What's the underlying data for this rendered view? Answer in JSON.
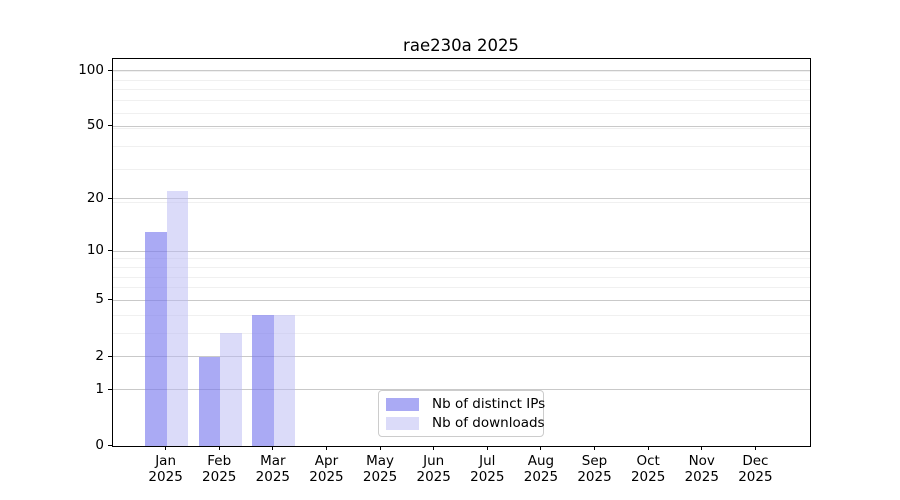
{
  "chart_data": {
    "type": "bar",
    "title": "rae230a 2025",
    "categories": [
      "Jan 2025",
      "Feb 2025",
      "Mar 2025",
      "Apr 2025",
      "May 2025",
      "Jun 2025",
      "Jul 2025",
      "Aug 2025",
      "Sep 2025",
      "Oct 2025",
      "Nov 2025",
      "Dec 2025"
    ],
    "series": [
      {
        "name": "Nb of distinct IPs",
        "color": "rgba(120,120,238,0.63)",
        "color_apparent": "#a9a9f3",
        "values": [
          13,
          2,
          4,
          0,
          0,
          0,
          0,
          0,
          0,
          0,
          0,
          0
        ]
      },
      {
        "name": "Nb of downloads",
        "color": "rgba(183,183,243,0.50)",
        "color_apparent": "#dbdbf9",
        "values": [
          22,
          3,
          4,
          0,
          0,
          0,
          0,
          0,
          0,
          0,
          0,
          0
        ]
      }
    ],
    "xlabel": "",
    "ylabel": "",
    "y_scale": "log10(1+x)",
    "ylim": [
      0,
      116
    ],
    "yticks": [
      0,
      1,
      2,
      5,
      10,
      20,
      50,
      100
    ],
    "y_minor_values": [
      3,
      4,
      6,
      7,
      8,
      9,
      19,
      29,
      39,
      49,
      59,
      69,
      79,
      89,
      99
    ],
    "grid": "both",
    "legend_position": "lower center",
    "colors": {
      "frame": "#000000",
      "grid_major": "#c9c9c9",
      "grid_minor": "#f0f0f0",
      "legend_border": "#cccccc",
      "text": "#000000"
    }
  }
}
